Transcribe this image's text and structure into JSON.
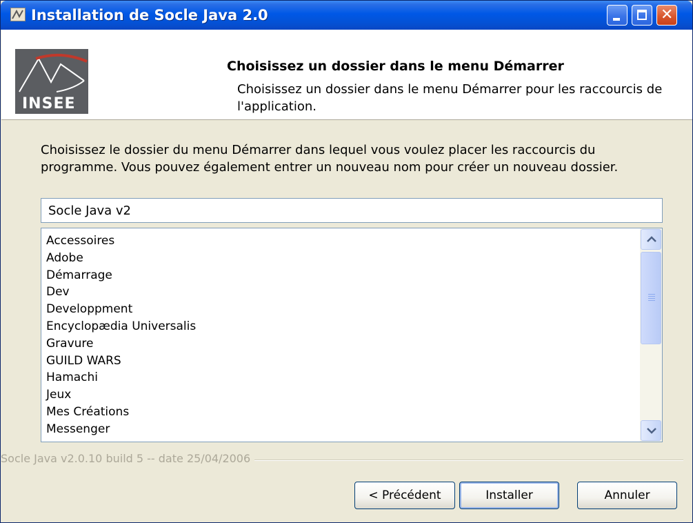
{
  "window": {
    "title": "Installation de Socle Java 2.0"
  },
  "header": {
    "logo_text": "INSEE",
    "title": "Choisissez un dossier dans le menu Démarrer",
    "subtitle": "Choisissez un dossier dans le menu Démarrer pour les raccourcis de l'application."
  },
  "body": {
    "description": "Choisissez le dossier du menu Démarrer dans lequel vous voulez placer les raccourcis du programme. Vous pouvez également entrer un nouveau nom pour créer un nouveau dossier.",
    "folder_input_value": "Socle Java v2",
    "folders": [
      "Accessoires",
      "Adobe",
      "Démarrage",
      "Dev",
      "Developpment",
      "Encyclopædia Universalis",
      "Gravure",
      "GUILD WARS",
      "Hamachi",
      "Jeux",
      "Mes Créations",
      "Messenger"
    ],
    "scroll_position": 0
  },
  "footer": {
    "version_text": "Socle Java v2.0.10 build 5 -- date 25/04/2006",
    "prev_label": "< Précédent",
    "install_label": "Installer",
    "cancel_label": "Annuler"
  },
  "colors": {
    "titlebar": "#0058e6",
    "window_bg": "#ece9d8",
    "close_button": "#d9582f",
    "logo_bg": "#5b5d61",
    "logo_arc": "#c0392b"
  }
}
